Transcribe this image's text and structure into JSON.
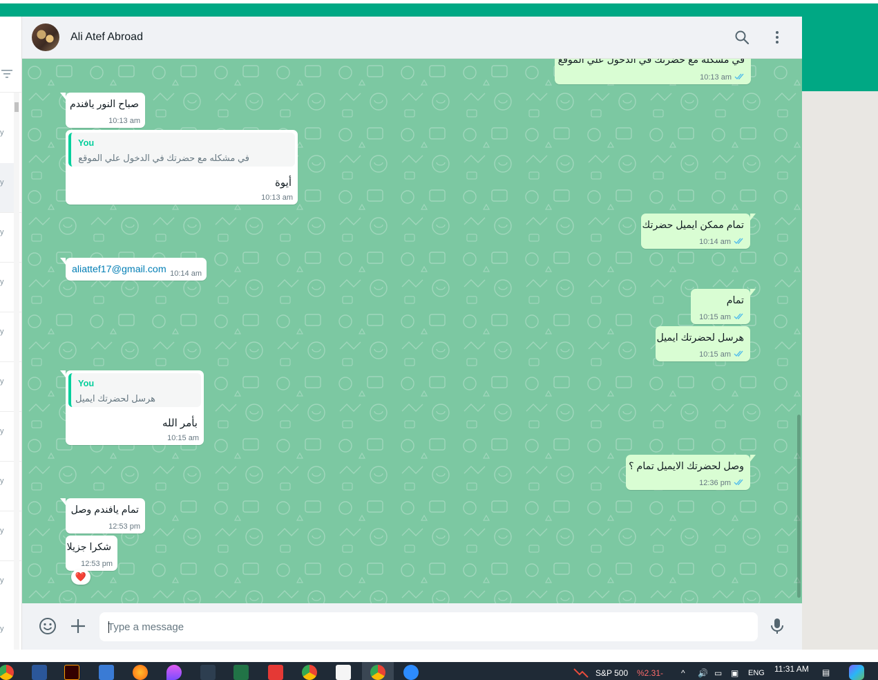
{
  "header": {
    "contact_name": "Ali Atef Abroad"
  },
  "messages": [
    {
      "dir": "out",
      "text": "في مشكله مع حضرتك في الدخول علي الموقع",
      "time": "10:13 am"
    },
    {
      "dir": "in",
      "text": "صباح النور يافندم",
      "time": "10:13 am"
    },
    {
      "dir": "in",
      "quote_author": "You",
      "quote_text": "في مشكله مع حضرتك في الدخول علي الموقع",
      "text": "أيوة",
      "time": "10:13 am"
    },
    {
      "dir": "out",
      "text": "تمام ممكن ايميل حضرتك",
      "time": "10:14 am"
    },
    {
      "dir": "in",
      "text": "aliattef17@gmail.com",
      "time": "10:14 am"
    },
    {
      "dir": "out",
      "text": "تمام",
      "time": "10:15 am"
    },
    {
      "dir": "out",
      "text": "هرسل لحضرتك ايميل",
      "time": "10:15 am"
    },
    {
      "dir": "in",
      "quote_author": "You",
      "quote_text": "هرسل لحضرتك ايميل",
      "text": "بأمر الله",
      "time": "10:15 am"
    },
    {
      "dir": "out",
      "text": "وصل لحضرتك الايميل تمام ؟",
      "time": "12:36 pm"
    },
    {
      "dir": "in",
      "text": "تمام يافندم وصل",
      "time": "12:53 pm"
    },
    {
      "dir": "in",
      "text": "شكرا جزيلا",
      "time": "12:53 pm",
      "reaction": "❤️"
    }
  ],
  "composer": {
    "placeholder": "Type a message"
  },
  "sidebar": {
    "row_suffix": "y"
  },
  "taskbar": {
    "ticker_name": "S&P 500",
    "ticker_change": "%2.31-",
    "language": "ENG",
    "clock": "11:31 AM"
  },
  "colors": {
    "brand_green": "#00a884",
    "outgoing_bubble": "#d9fdd3",
    "incoming_bubble": "#ffffff",
    "chat_background": "#7cc8a2",
    "quote_accent": "#06cf9c",
    "read_ticks": "#53bdeb"
  },
  "icons": [
    "search-icon",
    "menu-icon",
    "emoji-icon",
    "attach-plus-icon",
    "mic-icon",
    "filter-icon",
    "read-ticks-icon",
    "heart-reaction-icon"
  ]
}
